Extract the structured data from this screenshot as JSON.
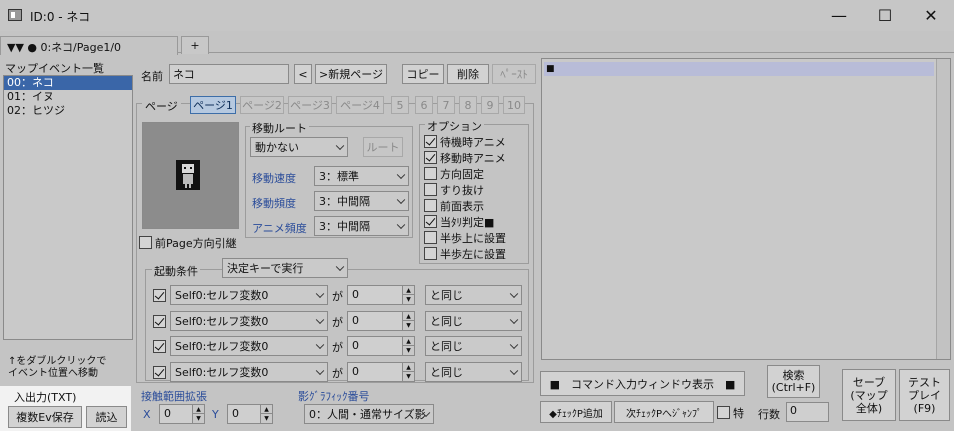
{
  "window": {
    "title": "ID:0 - ネコ",
    "minimize": "—",
    "maximize": "☐",
    "close": "✕"
  },
  "tabs": [
    {
      "label": "▼▼ ● 0:ネコ/Page1/0"
    },
    {
      "label": "+"
    }
  ],
  "map_events": {
    "title": "マップイベント一覧",
    "items": [
      "00：ネコ",
      "01：イヌ",
      "02：ヒツジ"
    ],
    "hint": [
      "↑をダブルクリックで",
      "イベント位置へ移動"
    ]
  },
  "io": {
    "title": "入出力(TXT)",
    "save": "複数Ev保存",
    "load": "読込"
  },
  "name_row": {
    "label": "名前",
    "value": "ネコ",
    "prev": "<",
    "new_page": ">新規ページ",
    "copy": "コピー",
    "delete": "削除",
    "paste": "ﾍﾟｰｽﾄ"
  },
  "page": {
    "label": "ページ",
    "tabs": [
      "ページ1",
      "ページ2",
      "ページ3",
      "ページ4",
      "5",
      "6",
      "7",
      "8",
      "9",
      "10"
    ]
  },
  "prev_page_dir": "前Page方向引継",
  "move_route": {
    "title": "移動ルート",
    "type": "動かない",
    "route_btn": "ルート",
    "speed_label": "移動速度",
    "speed": "3：標準",
    "freq_label": "移動頻度",
    "freq": "3：中間隔",
    "anim_label": "アニメ頻度",
    "anim": "3：中間隔"
  },
  "options": {
    "title": "オプション",
    "items": [
      {
        "label": "待機時アニメ",
        "checked": true
      },
      {
        "label": "移動時アニメ",
        "checked": true
      },
      {
        "label": "方向固定",
        "checked": false
      },
      {
        "label": "すり抜け",
        "checked": false
      },
      {
        "label": "前面表示",
        "checked": false
      },
      {
        "label": "当ﾀﾘ判定■",
        "checked": true
      },
      {
        "label": "半歩上に設置",
        "checked": false
      },
      {
        "label": "半歩左に設置",
        "checked": false
      }
    ]
  },
  "trigger": {
    "label": "起動条件",
    "value": "決定キーで実行",
    "conditions": [
      {
        "variable": "Self0:セルフ変数0",
        "ga": "が",
        "value": "0",
        "op": "と同じ"
      },
      {
        "variable": "Self0:セルフ変数0",
        "ga": "が",
        "value": "0",
        "op": "と同じ"
      },
      {
        "variable": "Self0:セルフ変数0",
        "ga": "が",
        "value": "0",
        "op": "と同じ"
      },
      {
        "variable": "Self0:セルフ変数0",
        "ga": "が",
        "value": "0",
        "op": "と同じ"
      }
    ]
  },
  "contact": {
    "title": "接触範囲拡張",
    "x_label": "X",
    "x": "0",
    "y_label": "Y",
    "y": "0"
  },
  "shadow": {
    "title": "影ｸﾞﾗﾌｨｯｸ番号",
    "value": "0：人間・通常サイズ影"
  },
  "commands": {
    "first_line": "■",
    "input_window": "■　コマンド入力ウィンドウ表示　■",
    "checkp_add": "◆ﾁｪｯｸP追加",
    "next_checkp": "次ﾁｪｯｸPへｼﾞｬﾝﾌﾟ",
    "special": "特",
    "lines_label": "行数",
    "lines": "0",
    "search": [
      "検索",
      "(Ctrl+F)"
    ],
    "save": [
      "セーブ",
      "(マップ",
      "全体)"
    ],
    "test": [
      "テスト",
      "プレイ",
      "(F9)"
    ]
  }
}
